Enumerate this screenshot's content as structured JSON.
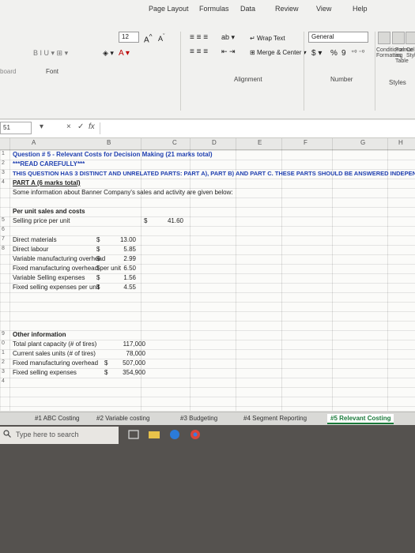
{
  "ribbon": {
    "tabs": [
      "Page Layout",
      "Formulas",
      "Data",
      "Review",
      "View",
      "Help"
    ],
    "font_size": "12",
    "font_group_label": "Font",
    "alignment_group_label": "Alignment",
    "number_group_label": "Number",
    "styles_group_label": "Styles",
    "wrap_text_label": "Wrap Text",
    "merge_center_label": "Merge & Center",
    "number_format": "General",
    "currency_symbol": "$",
    "percent_symbol": "%",
    "comma_symbol": "9",
    "cond_format_label": "Conditional Formatting",
    "format_table_label": "Format as Table",
    "cell_styles_label": "Cell Styles",
    "clipboard_label": "board"
  },
  "formula_bar": {
    "name_box": "51",
    "cancel": "×",
    "enter": "✓",
    "fx": "fx"
  },
  "columns": [
    "A",
    "B",
    "C",
    "D",
    "E",
    "F",
    "G",
    "H"
  ],
  "sheet": {
    "question_title": "Question # 5 - Relevant Costs for Decision Making (21 marks total)",
    "read_carefully": "***READ CAREFULLY***",
    "instruction": "THIS QUESTION HAS 3 DISTINCT AND UNRELATED PARTS: PART A), PART B) AND PART C. THESE PARTS SHOULD BE ANSWERED INDEPENDENTLY AND SEPARATE FROM E",
    "part_a": "PART A (6 marks total)",
    "intro": "Some information about Banner Company's sales and activity are given below:",
    "per_unit_heading": "Per unit sales and costs",
    "selling_price": {
      "label": "Selling price per unit",
      "symbol": "$",
      "value": "41.60"
    },
    "per_unit_items": [
      {
        "label": "Direct materials",
        "symbol": "$",
        "value": "13.00"
      },
      {
        "label": "Direct labour",
        "symbol": "$",
        "value": "5.85"
      },
      {
        "label": "Variable manufacturing overhead",
        "symbol": "$",
        "value": "2.99"
      },
      {
        "label": "Fixed manufacturing overhead per unit",
        "symbol": "$",
        "value": "6.50"
      },
      {
        "label": "Variable Selling expenses",
        "symbol": "$",
        "value": "1.56"
      },
      {
        "label": "Fixed selling expenses per unit",
        "symbol": "$",
        "value": "4.55"
      }
    ],
    "other_heading": "Other information",
    "other_items": [
      {
        "label": "Total plant capacity (# of tires)",
        "symbol": "",
        "value": "117,000"
      },
      {
        "label": "Current sales units (# of tires)",
        "symbol": "",
        "value": "78,000"
      },
      {
        "label": "Fixed manufacturing overhead",
        "symbol": "$",
        "value": "507,000"
      },
      {
        "label": "Fixed selling expenses",
        "symbol": "$",
        "value": "354,900"
      }
    ],
    "row_numbers": [
      "1",
      "2",
      "3",
      "4",
      "5",
      "6",
      "7",
      "8",
      "9",
      "0",
      "1",
      "2",
      "3",
      "4"
    ]
  },
  "sheet_tabs": [
    "#1 ABC Costing",
    "#2 Variable costing",
    "#3 Budgeting",
    "#4 Segment Reporting",
    "#5 Relevant Costing"
  ],
  "taskbar": {
    "search_placeholder": "Type here to search"
  },
  "colors": {
    "title_blue": "#1f3fb0",
    "excel_green": "#1a7a3a",
    "taskbar": "#55524f"
  }
}
